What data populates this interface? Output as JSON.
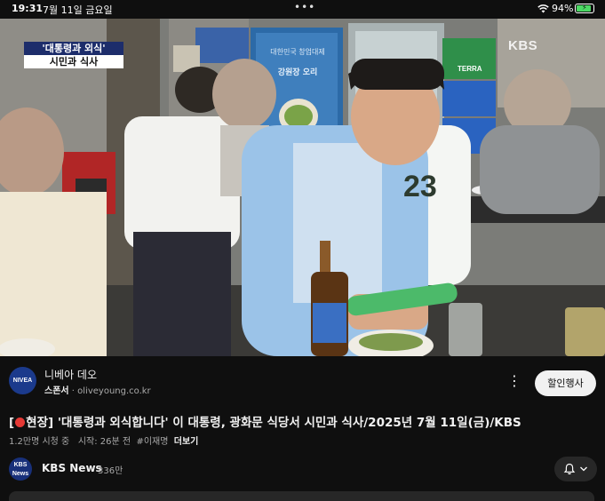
{
  "status_bar": {
    "time": "19:31",
    "date": "7월 11일 금요일",
    "dots": "•••",
    "battery_pct": "94%",
    "battery_level": 0.94,
    "battery_color": "#4cd964"
  },
  "video": {
    "caption_top": "'대통령과 외식'",
    "caption_bottom": "시민과 식사",
    "watermark": "KBS",
    "poster_line": "대한민국 창업대제",
    "poster_title": "강원장 오리",
    "beer_brand": "TERRA",
    "jersey_number": "23"
  },
  "ad": {
    "logo_text": "NIVEA",
    "title": "니베아 데오",
    "sponsor_label": "스폰서",
    "sponsor_url": "oliveyoung.co.kr",
    "more_icon": "more-vertical-icon",
    "cta_label": "할인행사"
  },
  "video_info": {
    "title_prefix": "[",
    "title_rest": "현장] '대통령과 외식합니다' 이 대통령, 광화문 식당서 시민과 식사/2025년 7월 11일(금)/KBS",
    "views": "1.2만명 시청 중",
    "started": "시작: 26분 전",
    "hashtag": "#이재명",
    "more_label": "더보기"
  },
  "channel": {
    "avatar_line1": "KBS",
    "avatar_line2": "News",
    "name": "KBS News",
    "subscribers": "336만",
    "bell_icon": "bell-icon"
  },
  "colors": {
    "background": "#0f0f0f",
    "live_red": "#e53935",
    "button_light": "#f1f1f1",
    "chip_dark": "#272727"
  }
}
